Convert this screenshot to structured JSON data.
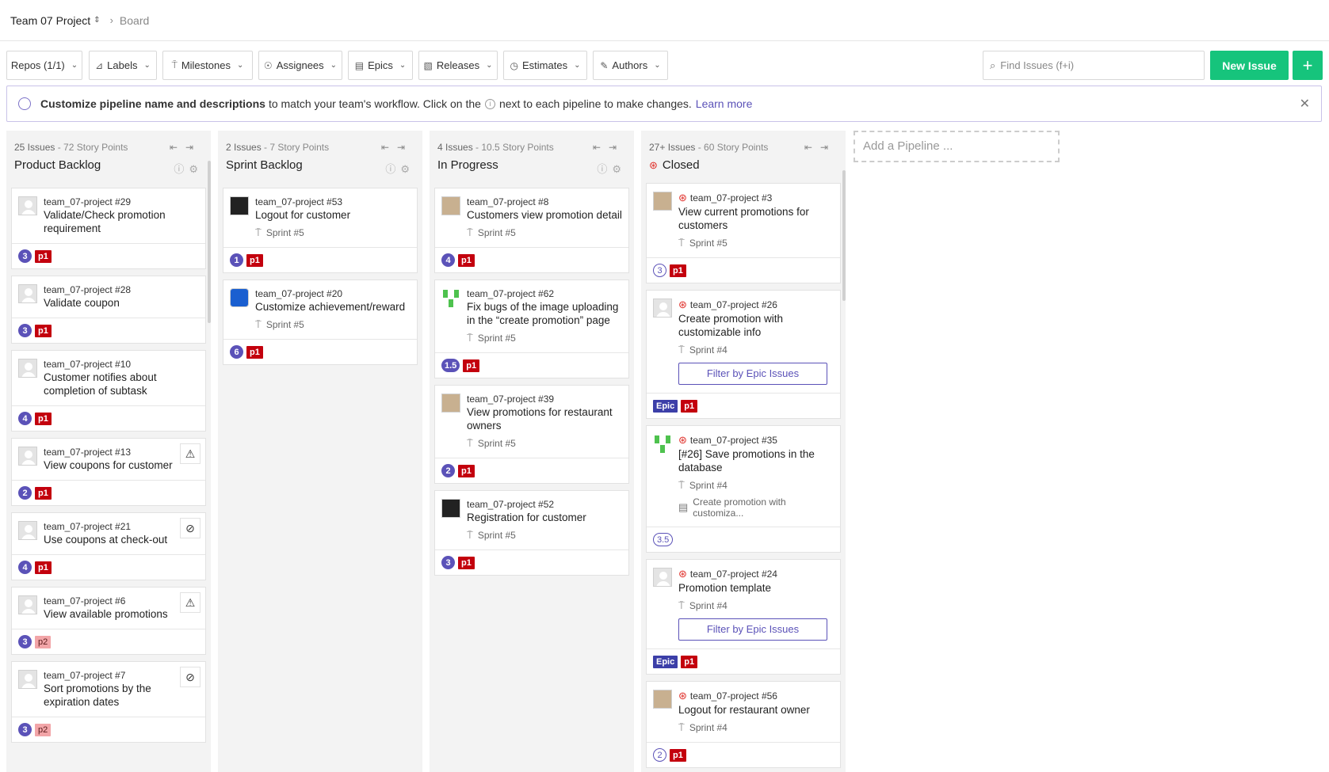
{
  "header": {
    "project": "Team 07 Project",
    "breadcrumb": "Board"
  },
  "filters": [
    {
      "label": "Repos (1/1)",
      "icon": ""
    },
    {
      "label": "Labels",
      "icon": "tag-icon"
    },
    {
      "label": "Milestones",
      "icon": "signpost-icon"
    },
    {
      "label": "Assignees",
      "icon": "person-icon"
    },
    {
      "label": "Epics",
      "icon": "epic-icon"
    },
    {
      "label": "Releases",
      "icon": "release-icon"
    },
    {
      "label": "Estimates",
      "icon": "estimate-icon"
    },
    {
      "label": "Authors",
      "icon": "pencil-icon"
    }
  ],
  "search": {
    "placeholder": "Find Issues (f+i)"
  },
  "new_issue_label": "New Issue",
  "plus_label": "+",
  "banner": {
    "bold": "Customize pipeline name and descriptions",
    "text1": "to match your team's workflow. Click on the",
    "text2": "next to each pipeline to make changes.",
    "link": "Learn more"
  },
  "add_pipeline": "Add a Pipeline ...",
  "filter_epic_label": "Filter by Epic Issues",
  "pipelines": [
    {
      "count": "25 Issues",
      "points": "- 72 Story Points",
      "name": "Product Backlog"
    },
    {
      "count": "2 Issues",
      "points": "- 7 Story Points",
      "name": "Sprint Backlog"
    },
    {
      "count": "4 Issues",
      "points": "- 10.5 Story Points",
      "name": "In Progress"
    },
    {
      "count": "27+ Issues",
      "points": "- 60 Story Points",
      "name": "Closed"
    }
  ],
  "cards": {
    "c29": {
      "repo": "team_07-project #29",
      "title": "Validate/Check promotion requirement",
      "est": "3",
      "label": "p1"
    },
    "c28": {
      "repo": "team_07-project #28",
      "title": "Validate coupon",
      "est": "3",
      "label": "p1"
    },
    "c10": {
      "repo": "team_07-project #10",
      "title": "Customer notifies about completion of subtask",
      "est": "4",
      "label": "p1"
    },
    "c13": {
      "repo": "team_07-project #13",
      "title": "View coupons for customer",
      "est": "2",
      "label": "p1"
    },
    "c21": {
      "repo": "team_07-project #21",
      "title": "Use coupons at check-out",
      "est": "4",
      "label": "p1"
    },
    "c6": {
      "repo": "team_07-project #6",
      "title": "View available promotions",
      "est": "3",
      "label": "p2"
    },
    "c7": {
      "repo": "team_07-project #7",
      "title": "Sort promotions by the expiration dates",
      "est": "3",
      "label": "p2"
    },
    "c53": {
      "repo": "team_07-project #53",
      "title": "Logout for customer",
      "sprint": "Sprint #5",
      "est": "1",
      "label": "p1"
    },
    "c20": {
      "repo": "team_07-project #20",
      "title": "Customize achievement/reward",
      "sprint": "Sprint #5",
      "est": "6",
      "label": "p1"
    },
    "c8": {
      "repo": "team_07-project #8",
      "title": "Customers view promotion detail",
      "sprint": "Sprint #5",
      "est": "4",
      "label": "p1"
    },
    "c62": {
      "repo": "team_07-project #62",
      "title": "Fix bugs of the image uploading in the “create promotion” page",
      "sprint": "Sprint #5",
      "est": "1.5",
      "label": "p1"
    },
    "c39": {
      "repo": "team_07-project #39",
      "title": "View promotions for restaurant owners",
      "sprint": "Sprint #5",
      "est": "2",
      "label": "p1"
    },
    "c52": {
      "repo": "team_07-project #52",
      "title": "Registration for customer",
      "sprint": "Sprint #5",
      "est": "3",
      "label": "p1"
    },
    "c3": {
      "repo": "team_07-project #3",
      "title": "View current promotions for customers",
      "sprint": "Sprint #5",
      "est": "3",
      "label": "p1"
    },
    "c26": {
      "repo": "team_07-project #26",
      "title": "Create promotion with customizable info",
      "sprint": "Sprint #4",
      "epic": "Epic",
      "label": "p1"
    },
    "c35": {
      "repo": "team_07-project #35",
      "title": "[#26] Save promotions in the database",
      "sprint": "Sprint #4",
      "parent": "Create promotion with customiza...",
      "est": "3.5"
    },
    "c24": {
      "repo": "team_07-project #24",
      "title": "Promotion template",
      "sprint": "Sprint #4",
      "epic": "Epic",
      "label": "p1"
    },
    "c56": {
      "repo": "team_07-project #56",
      "title": "Logout for restaurant owner",
      "sprint": "Sprint #4",
      "est": "2",
      "label": "p1"
    }
  }
}
